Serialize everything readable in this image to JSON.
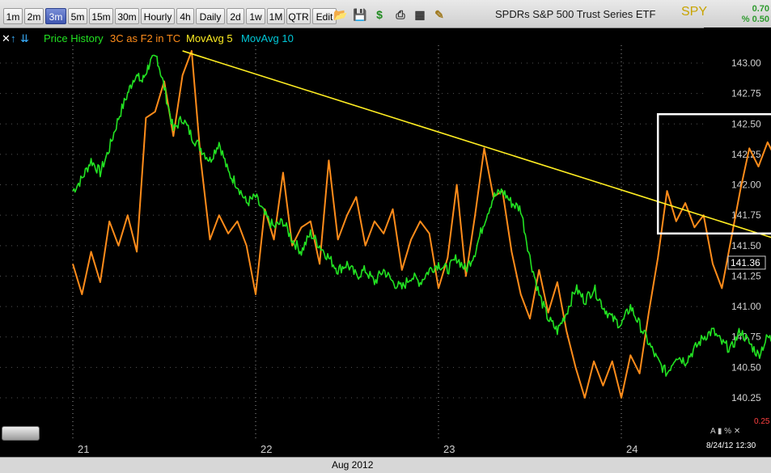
{
  "toolbar": {
    "timeframes": [
      "1m",
      "2m",
      "3m",
      "5m",
      "15m",
      "30m",
      "Hourly",
      "4h",
      "Daily",
      "2d",
      "1w",
      "1M",
      "QTR",
      "Edit"
    ],
    "active_timeframe": "3m",
    "icons": [
      "folder-icon",
      "save-icon",
      "dollar-icon",
      "print-icon",
      "grid-icon",
      "pencil-icon"
    ]
  },
  "header": {
    "title": "SPDRs S&P 500 Trust Series ETF",
    "symbol": "SPY",
    "change_abs": "0.70",
    "change_pct": "% 0.50"
  },
  "legend": {
    "close_symbol": "✕",
    "up_arrow": "↑",
    "down_arrows": "⇊",
    "price": "Price History",
    "indicator": "3C as F2 in TC",
    "ma5": "MovAvg 5",
    "ma10": "MovAvg 10"
  },
  "colors": {
    "price": "#22e222",
    "indicator": "#ff8c1a",
    "trendline": "#ffee22",
    "ma10": "#00c8d8",
    "grid": "#d0d0d0",
    "box": "#ffffff",
    "axis_text": "#cfcfcf"
  },
  "bottom": {
    "month": "Aug 2012",
    "timestamp": "8/24/12 12:30",
    "lower_tick": "0.25",
    "mini_controls": "A ▮ % ✕"
  },
  "chart_data": {
    "type": "line",
    "x_ticks": [
      "21",
      "22",
      "23",
      "24"
    ],
    "ylim": [
      140.0,
      143.2
    ],
    "y_ticks": [
      "143.00",
      "142.75",
      "142.50",
      "142.25",
      "142.00",
      "141.75",
      "141.50",
      "141.25",
      "141.00",
      "140.75",
      "140.50",
      "140.25"
    ],
    "last_price": "141.36",
    "grid": "vertical dotted",
    "series": [
      {
        "name": "Price History",
        "note_units": "price",
        "points": [
          [
            0.0,
            141.95
          ],
          [
            0.05,
            142.05
          ],
          [
            0.1,
            142.2
          ],
          [
            0.15,
            142.1
          ],
          [
            0.2,
            142.3
          ],
          [
            0.25,
            142.55
          ],
          [
            0.3,
            142.75
          ],
          [
            0.34,
            142.9
          ],
          [
            0.38,
            142.85
          ],
          [
            0.42,
            143.0
          ],
          [
            0.46,
            143.05
          ],
          [
            0.5,
            142.8
          ],
          [
            0.55,
            142.45
          ],
          [
            0.6,
            142.55
          ],
          [
            0.65,
            142.4
          ],
          [
            0.7,
            142.3
          ],
          [
            0.75,
            142.2
          ],
          [
            0.8,
            142.35
          ],
          [
            0.85,
            142.1
          ],
          [
            0.9,
            142.0
          ],
          [
            0.95,
            141.85
          ],
          [
            1.0,
            141.9
          ],
          [
            1.05,
            141.75
          ],
          [
            1.1,
            141.65
          ],
          [
            1.15,
            141.7
          ],
          [
            1.2,
            141.55
          ],
          [
            1.25,
            141.45
          ],
          [
            1.3,
            141.6
          ],
          [
            1.35,
            141.5
          ],
          [
            1.4,
            141.4
          ],
          [
            1.45,
            141.3
          ],
          [
            1.5,
            141.35
          ],
          [
            1.55,
            141.25
          ],
          [
            1.6,
            141.3
          ],
          [
            1.65,
            141.2
          ],
          [
            1.7,
            141.3
          ],
          [
            1.75,
            141.2
          ],
          [
            1.8,
            141.15
          ],
          [
            1.85,
            141.25
          ],
          [
            1.9,
            141.2
          ],
          [
            1.95,
            141.3
          ],
          [
            2.0,
            141.35
          ],
          [
            2.05,
            141.3
          ],
          [
            2.1,
            141.4
          ],
          [
            2.15,
            141.3
          ],
          [
            2.2,
            141.45
          ],
          [
            2.25,
            141.7
          ],
          [
            2.3,
            141.9
          ],
          [
            2.35,
            141.95
          ],
          [
            2.4,
            141.85
          ],
          [
            2.45,
            141.8
          ],
          [
            2.5,
            141.4
          ],
          [
            2.55,
            141.1
          ],
          [
            2.6,
            140.9
          ],
          [
            2.65,
            140.8
          ],
          [
            2.7,
            140.95
          ],
          [
            2.75,
            141.15
          ],
          [
            2.8,
            141.05
          ],
          [
            2.85,
            141.15
          ],
          [
            2.9,
            141.0
          ],
          [
            2.95,
            140.9
          ],
          [
            3.0,
            140.85
          ],
          [
            3.05,
            141.0
          ],
          [
            3.1,
            140.85
          ],
          [
            3.15,
            140.7
          ],
          [
            3.2,
            140.55
          ],
          [
            3.25,
            140.45
          ],
          [
            3.3,
            140.6
          ],
          [
            3.35,
            140.55
          ],
          [
            3.4,
            140.65
          ],
          [
            3.45,
            140.75
          ],
          [
            3.5,
            140.8
          ],
          [
            3.55,
            140.7
          ],
          [
            3.6,
            140.65
          ],
          [
            3.65,
            140.8
          ],
          [
            3.7,
            140.7
          ],
          [
            3.75,
            140.6
          ],
          [
            3.8,
            140.75
          ],
          [
            3.85,
            140.7
          ],
          [
            3.9,
            140.55
          ],
          [
            3.95,
            140.4
          ],
          [
            4.0,
            140.3
          ],
          [
            4.05,
            140.25
          ],
          [
            4.1,
            140.4
          ],
          [
            4.15,
            140.55
          ],
          [
            4.2,
            140.75
          ],
          [
            4.25,
            140.9
          ],
          [
            4.3,
            141.1
          ],
          [
            4.35,
            141.35
          ],
          [
            4.4,
            141.25
          ],
          [
            4.45,
            141.3
          ],
          [
            4.5,
            141.2
          ],
          [
            4.55,
            141.3
          ],
          [
            4.6,
            141.36
          ]
        ]
      },
      {
        "name": "3C as F2 in TC",
        "note_units": "price-scaled",
        "points": [
          [
            0.0,
            141.35
          ],
          [
            0.05,
            141.1
          ],
          [
            0.1,
            141.45
          ],
          [
            0.15,
            141.2
          ],
          [
            0.2,
            141.7
          ],
          [
            0.25,
            141.5
          ],
          [
            0.3,
            141.75
          ],
          [
            0.35,
            141.45
          ],
          [
            0.4,
            142.55
          ],
          [
            0.45,
            142.6
          ],
          [
            0.5,
            142.85
          ],
          [
            0.55,
            142.4
          ],
          [
            0.6,
            142.9
          ],
          [
            0.65,
            143.1
          ],
          [
            0.7,
            142.2
          ],
          [
            0.75,
            141.55
          ],
          [
            0.8,
            141.75
          ],
          [
            0.85,
            141.6
          ],
          [
            0.9,
            141.7
          ],
          [
            0.95,
            141.5
          ],
          [
            1.0,
            141.1
          ],
          [
            1.05,
            141.8
          ],
          [
            1.1,
            141.55
          ],
          [
            1.15,
            142.1
          ],
          [
            1.2,
            141.5
          ],
          [
            1.25,
            141.65
          ],
          [
            1.3,
            141.7
          ],
          [
            1.35,
            141.35
          ],
          [
            1.4,
            142.2
          ],
          [
            1.45,
            141.55
          ],
          [
            1.5,
            141.75
          ],
          [
            1.55,
            141.9
          ],
          [
            1.6,
            141.5
          ],
          [
            1.65,
            141.7
          ],
          [
            1.7,
            141.6
          ],
          [
            1.75,
            141.8
          ],
          [
            1.8,
            141.3
          ],
          [
            1.85,
            141.55
          ],
          [
            1.9,
            141.7
          ],
          [
            1.95,
            141.6
          ],
          [
            2.0,
            141.15
          ],
          [
            2.05,
            141.4
          ],
          [
            2.1,
            142.0
          ],
          [
            2.15,
            141.25
          ],
          [
            2.2,
            141.75
          ],
          [
            2.25,
            142.3
          ],
          [
            2.3,
            141.9
          ],
          [
            2.35,
            141.95
          ],
          [
            2.4,
            141.45
          ],
          [
            2.45,
            141.1
          ],
          [
            2.5,
            140.9
          ],
          [
            2.55,
            141.3
          ],
          [
            2.6,
            140.95
          ],
          [
            2.65,
            141.2
          ],
          [
            2.7,
            140.8
          ],
          [
            2.75,
            140.5
          ],
          [
            2.8,
            140.25
          ],
          [
            2.85,
            140.55
          ],
          [
            2.9,
            140.35
          ],
          [
            2.95,
            140.55
          ],
          [
            3.0,
            140.25
          ],
          [
            3.05,
            140.6
          ],
          [
            3.1,
            140.45
          ],
          [
            3.15,
            140.95
          ],
          [
            3.2,
            141.4
          ],
          [
            3.25,
            141.95
          ],
          [
            3.3,
            141.7
          ],
          [
            3.35,
            141.85
          ],
          [
            3.4,
            141.65
          ],
          [
            3.45,
            141.75
          ],
          [
            3.5,
            141.35
          ],
          [
            3.55,
            141.15
          ],
          [
            3.6,
            141.55
          ],
          [
            3.65,
            141.95
          ],
          [
            3.7,
            142.3
          ],
          [
            3.75,
            142.15
          ],
          [
            3.8,
            142.35
          ],
          [
            3.85,
            142.2
          ],
          [
            3.9,
            142.6
          ],
          [
            3.95,
            142.2
          ],
          [
            4.0,
            142.45
          ],
          [
            4.05,
            142.25
          ],
          [
            4.1,
            142.3
          ],
          [
            4.15,
            142.0
          ],
          [
            4.2,
            142.25
          ]
        ]
      },
      {
        "name": "MovAvg 10",
        "note_units": "price",
        "points": [
          [
            3.95,
            140.68
          ],
          [
            4.65,
            140.68
          ]
        ]
      }
    ],
    "annotations": {
      "trendline": {
        "from": [
          0.6,
          143.1
        ],
        "to": [
          4.55,
          141.22
        ]
      },
      "box": {
        "x0": 3.2,
        "x1": 4.55,
        "y0": 141.6,
        "y1": 142.58
      }
    }
  }
}
